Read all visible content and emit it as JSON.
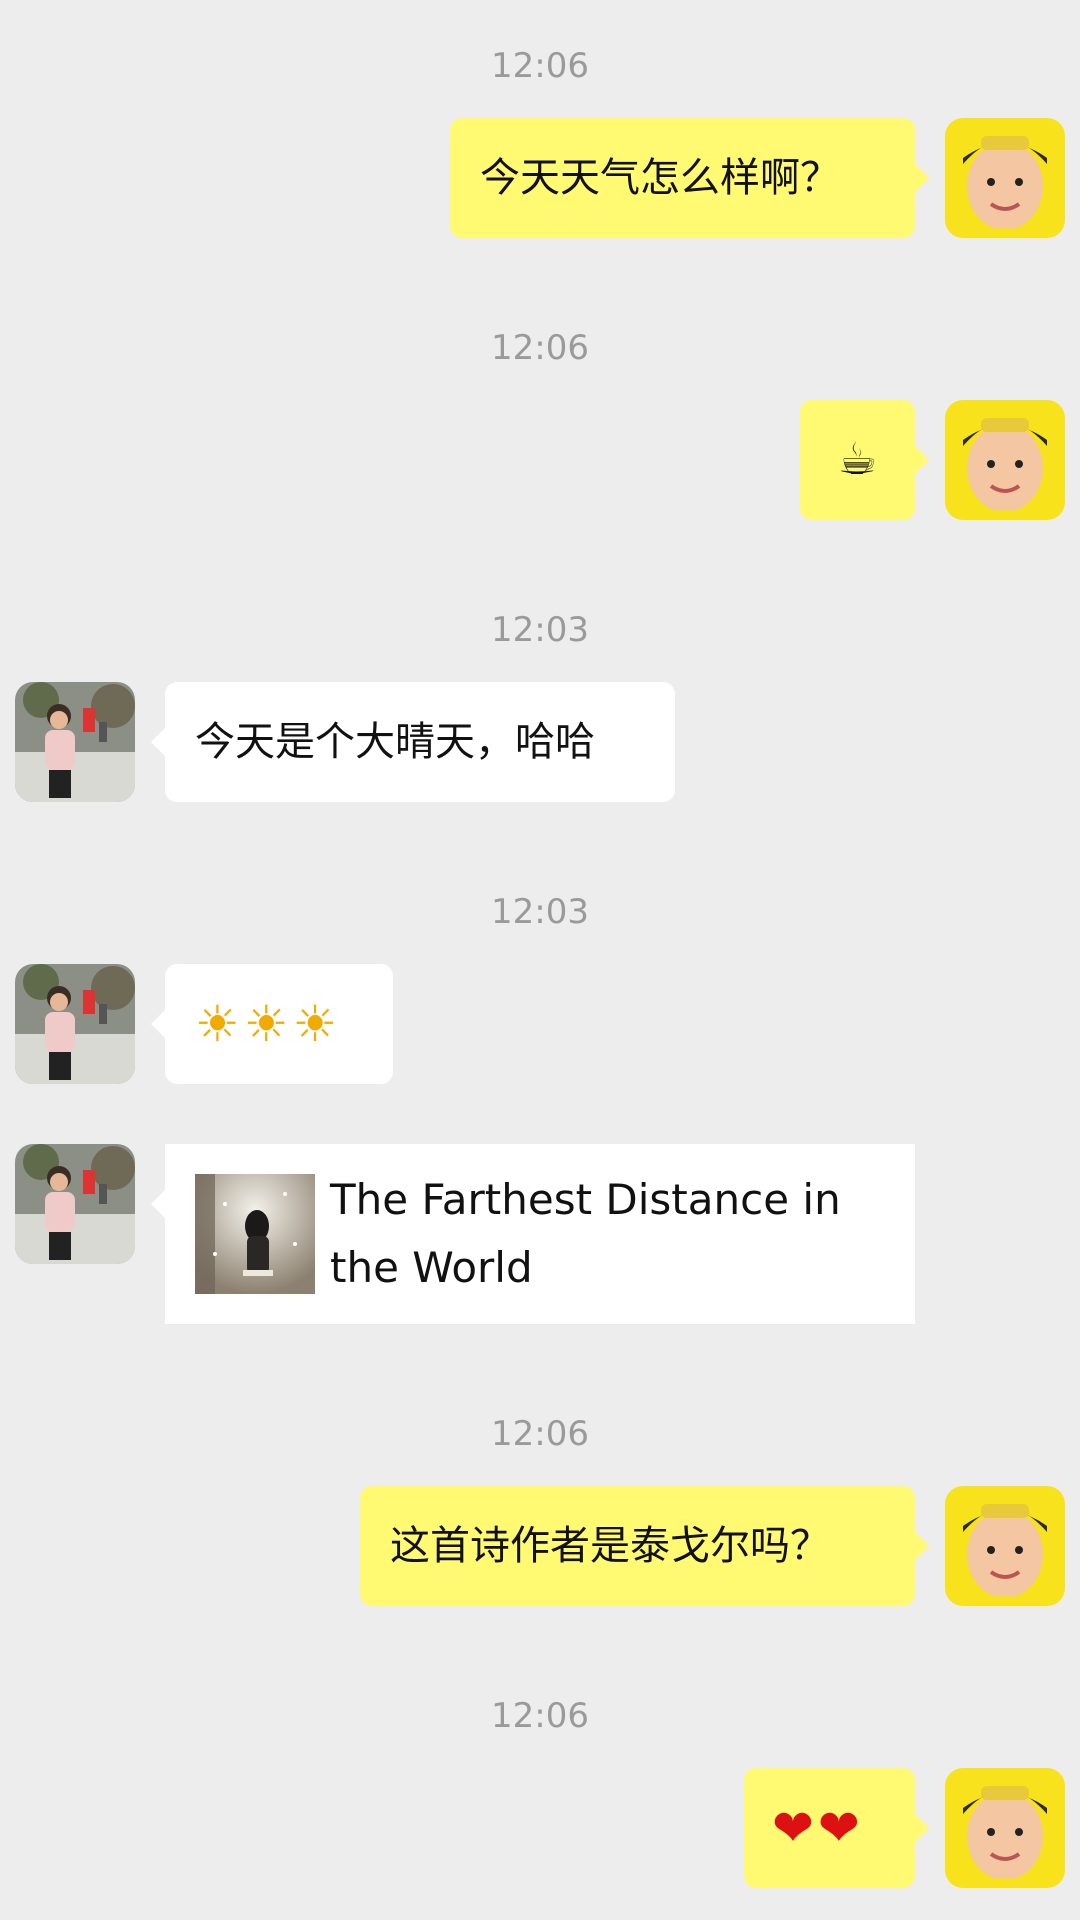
{
  "messages": [
    {
      "time": "12:06",
      "text": "今天天气怎么样啊？"
    },
    {
      "time": "12:06",
      "emoji": "☕"
    },
    {
      "time": "12:03",
      "text": "今天是个大晴天，哈哈"
    },
    {
      "time": "12:03",
      "emoji": "☀☀☀"
    },
    {
      "link_title": "The Farthest Distance in the World"
    },
    {
      "time": "12:06",
      "text": "这首诗作者是泰戈尔吗？"
    },
    {
      "time": "12:06",
      "emoji": "❤❤"
    }
  ],
  "colors": {
    "background": "#ededed",
    "my_bubble": "#fffa72",
    "other_bubble": "#ffffff",
    "timestamp": "#9a9a9a"
  }
}
